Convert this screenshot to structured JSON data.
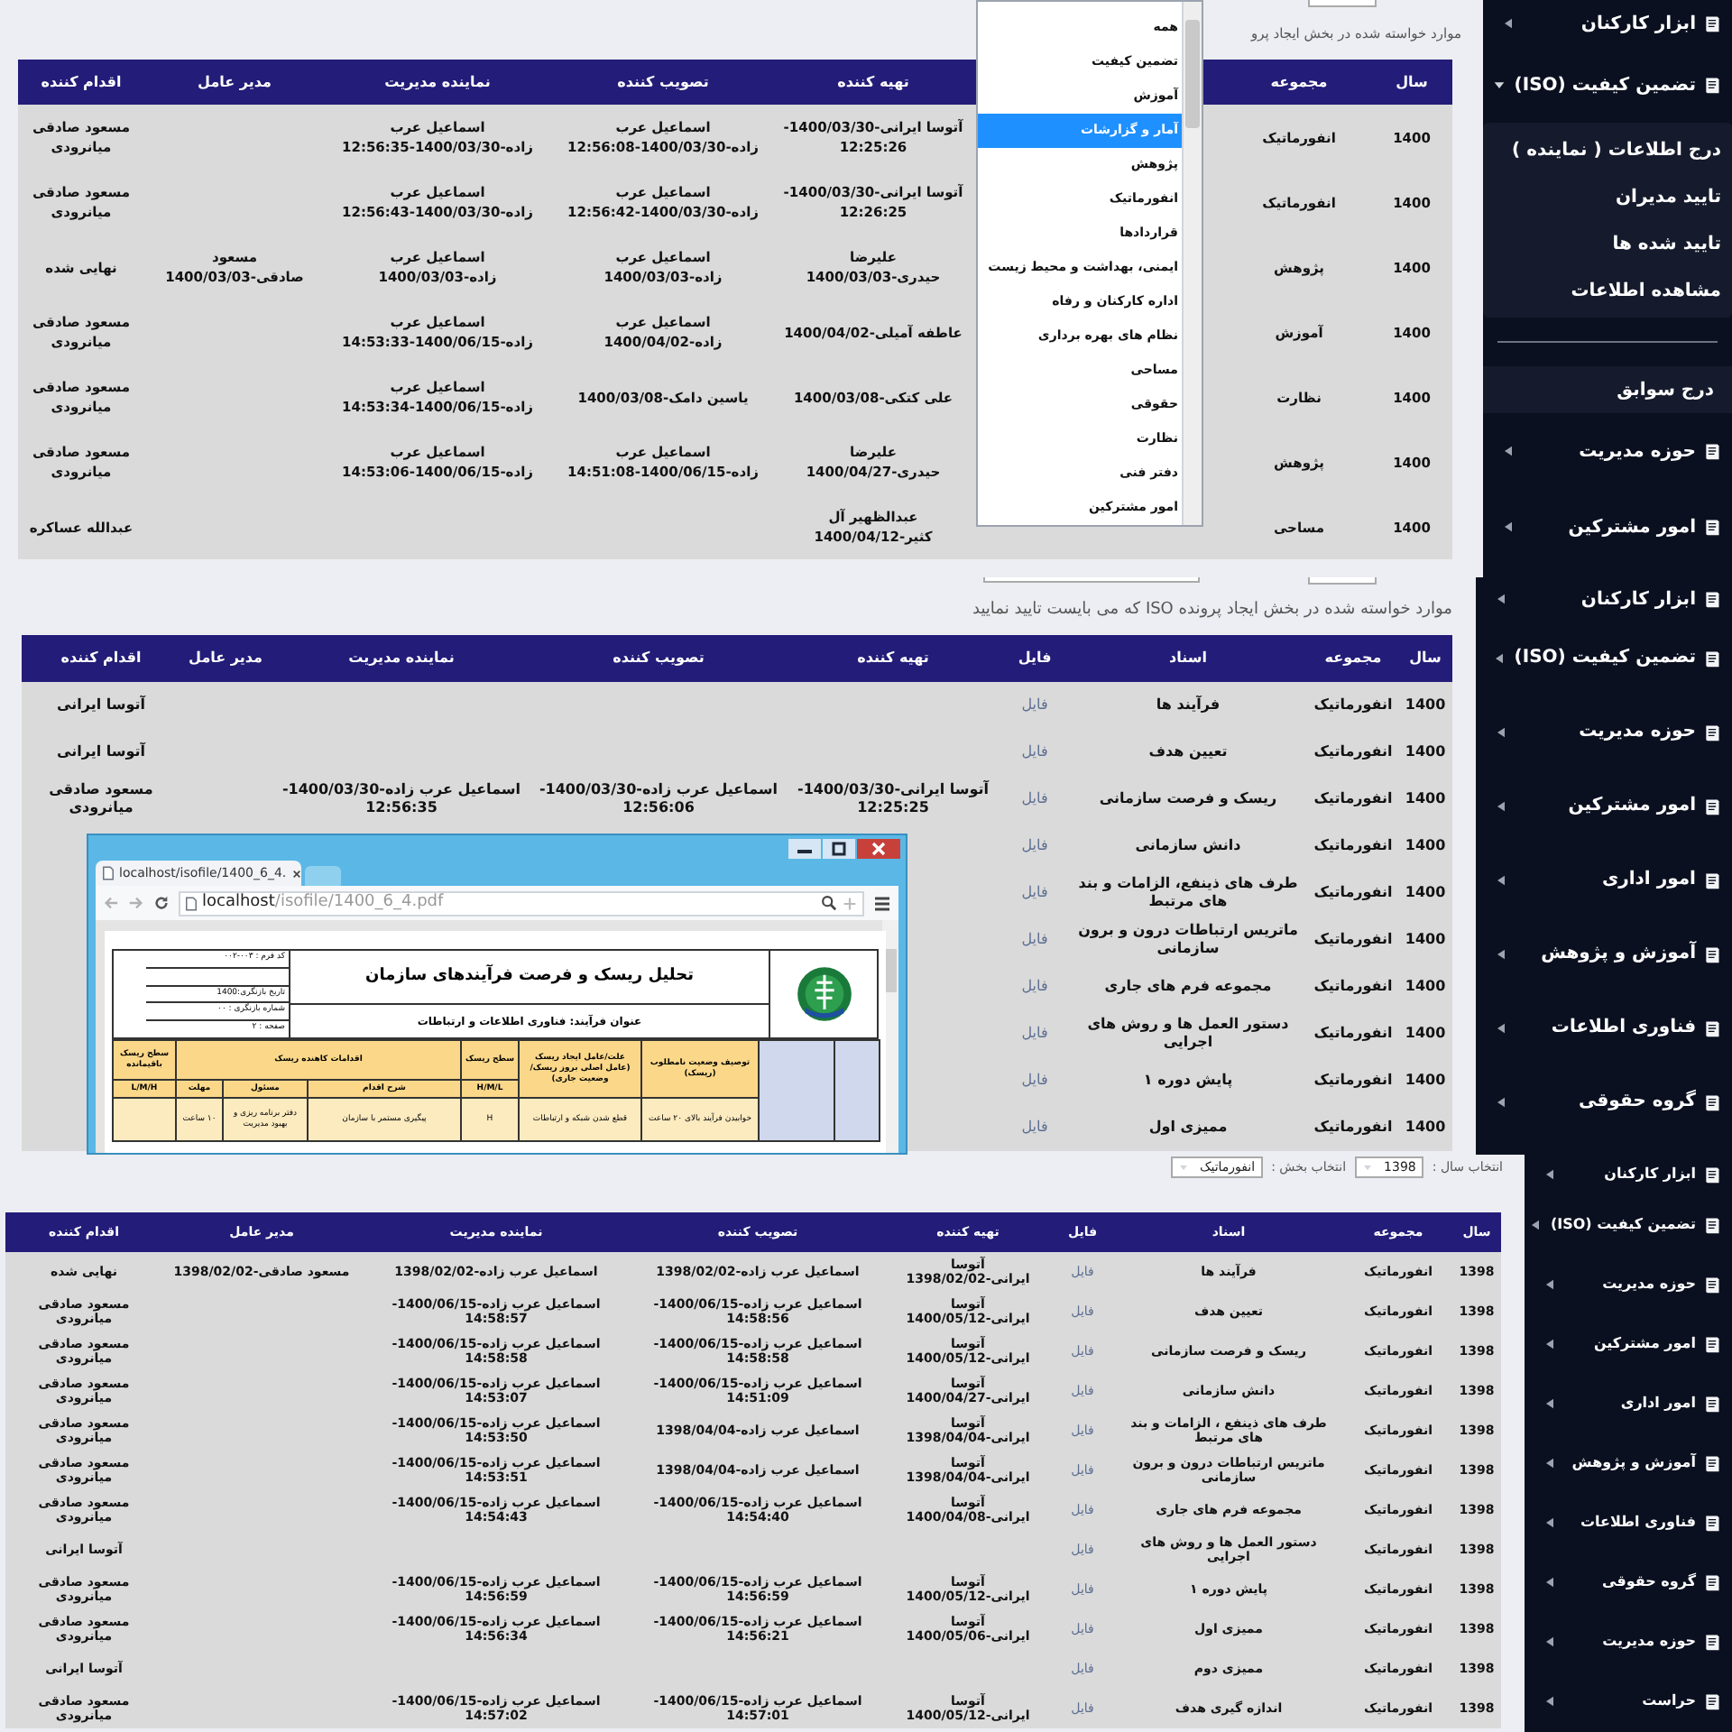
{
  "panels": [
    {
      "description": "موارد خواسته شده در بخش ایجاد پرو",
      "columns": [
        {
          "label": "سال",
          "kind": "text"
        },
        {
          "label": "مجموعه",
          "kind": "text"
        },
        {
          "label": "تهیه کننده",
          "kind": "text"
        },
        {
          "label": "تصویب کننده",
          "kind": "text"
        },
        {
          "label": "نماینده مدیریت",
          "kind": "text"
        },
        {
          "label": "مدیر عامل",
          "kind": "text"
        },
        {
          "label": "اقدام کننده",
          "kind": "text"
        }
      ],
      "rows": [
        [
          "1400",
          "انفورماتیک",
          "آتوسا ایرانی-1400/03/30-12:25:26",
          "اسماعیل عرب زاده-1400/03/30-12:56:08",
          "اسماعیل عرب زاده-1400/03/30-12:56:35",
          null,
          "مسعود صادقی میانرودی"
        ],
        [
          "1400",
          "انفورماتیک",
          "آتوسا ایرانی-1400/03/30-12:26:25",
          "اسماعیل عرب زاده-1400/03/30-12:56:42",
          "اسماعیل عرب زاده-1400/03/30-12:56:43",
          null,
          "مسعود صادقی میانرودی"
        ],
        [
          "1400",
          "پژوهش",
          "علیرضا حیدری-1400/03/03",
          "اسماعیل عرب زاده-1400/03/03",
          "اسماعیل عرب زاده-1400/03/03",
          "مسعود صادقی-1400/03/03",
          "نهایی شده"
        ],
        [
          "1400",
          "آموزش",
          "عاطفه آمیلی-1400/04/02",
          "اسماعیل عرب زاده-1400/04/02",
          "اسماعیل عرب زاده-1400/06/15-14:53:33",
          null,
          "مسعود صادقی میانرودی"
        ],
        [
          "1400",
          "نظارت",
          "علی کتکی-1400/03/08",
          "یاسین دامک-1400/03/08",
          "اسماعیل عرب زاده-1400/06/15-14:53:34",
          null,
          "مسعود صادقی میانرودی"
        ],
        [
          "1400",
          "پژوهش",
          "علیرضا حیدری-1400/04/27",
          "اسماعیل عرب زاده-1400/06/15-14:51:08",
          "اسماعیل عرب زاده-1400/06/15-14:53:06",
          null,
          "مسعود صادقی میانرودی"
        ],
        [
          "1400",
          "مساحی",
          "عبدالظهیر آل کثیر-1400/04/12",
          null,
          null,
          null,
          "عبدالله عساکره"
        ]
      ],
      "dropdown": {
        "options": [
          {
            "label": "همه",
            "selected": false
          },
          {
            "label": "تضمین کیفیت",
            "selected": false
          },
          {
            "label": "آموزش",
            "selected": false
          },
          {
            "label": "آمار و گزارشات",
            "selected": true
          },
          {
            "label": "پژوهش",
            "selected": false
          },
          {
            "label": "انفورماتیک",
            "selected": false
          },
          {
            "label": "قراردادها",
            "selected": false
          },
          {
            "label": "ایمنی، بهداشت و محیط زیست",
            "selected": false
          },
          {
            "label": "اداره کارکنان و رفاه",
            "selected": false
          },
          {
            "label": "نظام های بهره برداری",
            "selected": false
          },
          {
            "label": "مساحی",
            "selected": false
          },
          {
            "label": "حقوقی",
            "selected": false
          },
          {
            "label": "نظارت",
            "selected": false
          },
          {
            "label": "دفتر فنی",
            "selected": false
          },
          {
            "label": "امور مشترکین",
            "selected": false
          }
        ]
      },
      "sidebar": [
        {
          "kind": "menu",
          "label": "ابزار کارکنان",
          "expanded": false
        },
        {
          "kind": "menu",
          "label": "تضمین کیفیت (ISO)",
          "expanded": true,
          "children": [
            {
              "label": "درج اطلاعات ( نماینده )"
            },
            {
              "label": "تایید مدیران"
            },
            {
              "label": "تایید شده ها"
            },
            {
              "label": "مشاهده اطلاعات"
            }
          ]
        },
        {
          "kind": "divider"
        },
        {
          "kind": "link",
          "label": "درج سوابق"
        },
        {
          "kind": "menu",
          "label": "حوزه مدیریت",
          "expanded": false
        },
        {
          "kind": "menu",
          "label": "امور مشترکین",
          "expanded": false
        }
      ]
    },
    {
      "description": "موارد خواسته شده در بخش ایجاد پرونده ISO که می بایست تایید نمایید",
      "columns": [
        {
          "label": "سال",
          "kind": "text"
        },
        {
          "label": "مجموعه",
          "kind": "text"
        },
        {
          "label": "اسناد",
          "kind": "text"
        },
        {
          "label": "فایل",
          "kind": "link"
        },
        {
          "label": "تهیه کننده",
          "kind": "text"
        },
        {
          "label": "تصویب کننده",
          "kind": "text"
        },
        {
          "label": "نماینده مدیریت",
          "kind": "text"
        },
        {
          "label": "مدیر عامل",
          "kind": "text"
        },
        {
          "label": "اقدام کننده",
          "kind": "text"
        }
      ],
      "rows": [
        [
          "1400",
          "انفورماتیک",
          "فرآیند ها",
          "فایل",
          null,
          null,
          null,
          null,
          "آتوسا ایرانی"
        ],
        [
          "1400",
          "انفورماتیک",
          "تعیین هدف",
          "فایل",
          null,
          null,
          null,
          null,
          "آتوسا ایرانی"
        ],
        [
          "1400",
          "انفورماتیک",
          "ریسک و فرصت سازمانی",
          "فایل",
          "آتوسا ایرانی-1400/03/30-12:25:25",
          "اسماعیل عرب زاده-1400/03/30-12:56:06",
          "اسماعیل عرب زاده-1400/03/30-12:56:35",
          null,
          "مسعود صادقی میانرودی"
        ],
        [
          "1400",
          "انفورماتیک",
          "دانش سازمانی",
          "فایل",
          null,
          null,
          null,
          null,
          null
        ],
        [
          "1400",
          "انفورماتیک",
          "طرف های ذینفع، الزامات و بند های مرتبط",
          "فایل",
          null,
          null,
          null,
          null,
          null
        ],
        [
          "1400",
          "انفورماتیک",
          "ماتریس ارتباطات درون و برون سازمانی",
          "فایل",
          null,
          null,
          null,
          null,
          null
        ],
        [
          "1400",
          "انفورماتیک",
          "مجموعه فرم های جاری",
          "فایل",
          null,
          null,
          null,
          null,
          null
        ],
        [
          "1400",
          "انفورماتیک",
          "دستور العمل ها و روش های اجرایی",
          "فایل",
          null,
          null,
          null,
          null,
          null
        ],
        [
          "1400",
          "انفورماتیک",
          "پایش دوره ۱",
          "فایل",
          null,
          null,
          null,
          null,
          null
        ],
        [
          "1400",
          "انفورماتیک",
          "ممیزی اول",
          "فایل",
          null,
          null,
          null,
          null,
          null
        ]
      ],
      "browser_window": {
        "tab_title": "localhost/isofile/1400_6_4.",
        "url_host": "localhost",
        "url_path": "/isofile/1400_6_4.pdf",
        "document": {
          "info": [
            "کد فرم : ۰۰۳-۰۰۲",
            "تاریخ بازنگری:1400",
            "شماره بازنگری : ۰۰",
            "صفحه : ۲"
          ],
          "title": "تحلیل ریسک و فرصت فرآیندهای سازمان",
          "subtitle": "عنوان فرآیند: فناوری اطلاعات و ارتباطات",
          "headers": [
            "توصیف وضعیت نامطلوب (ریسک)",
            "علت/عامل ایجاد ریسک (عامل اصلی بروز ریسک/ وضعیت جاری)",
            "سطح ریسک",
            "اقدامات کاهنده ریسک",
            "سطح ریسک باقیمانده"
          ],
          "subheaders": [
            "H/M/L",
            "شرح اقدام",
            "مسئول",
            "مهلت",
            "L/M/H"
          ],
          "row": [
            "خوابیدن فرآیند بالای ۲۰ ساعت",
            "قطع شدن شبکه و ارتباطات",
            "H",
            "پیگیری مستمر با سازمان",
            "دفتر برنامه ریزی و بهبود مدیریت",
            "۱۰ ساعت"
          ]
        }
      },
      "sidebar": [
        {
          "kind": "menu",
          "label": "ابزار کارکنان",
          "expanded": false
        },
        {
          "kind": "menu",
          "label": "تضمین کیفیت (ISO)",
          "expanded": false
        },
        {
          "kind": "menu",
          "label": "حوزه مدیریت",
          "expanded": false
        },
        {
          "kind": "menu",
          "label": "امور مشترکین",
          "expanded": false
        },
        {
          "kind": "menu",
          "label": "امور اداری",
          "expanded": false
        },
        {
          "kind": "menu",
          "label": "آموزش و پژوهش",
          "expanded": false
        },
        {
          "kind": "menu",
          "label": "فناوری اطلاعات",
          "expanded": false
        },
        {
          "kind": "menu",
          "label": "گروه حقوقی",
          "expanded": false
        }
      ]
    },
    {
      "filters": [
        {
          "label": "انتخاب سال :",
          "value": "1398"
        },
        {
          "label": "انتخاب بخش :",
          "value": "انفورماتیک"
        }
      ],
      "columns": [
        {
          "label": "سال",
          "kind": "text"
        },
        {
          "label": "مجموعه",
          "kind": "text"
        },
        {
          "label": "اسناد",
          "kind": "text"
        },
        {
          "label": "فایل",
          "kind": "link"
        },
        {
          "label": "تهیه کننده",
          "kind": "text"
        },
        {
          "label": "تصویب کننده",
          "kind": "text"
        },
        {
          "label": "نماینده مدیریت",
          "kind": "text"
        },
        {
          "label": "مدیر عامل",
          "kind": "text"
        },
        {
          "label": "اقدام کننده",
          "kind": "text"
        }
      ],
      "rows": [
        [
          "1398",
          "انفورماتیک",
          "فرآیند ها",
          "فایل",
          "آتوسا ایرانی-1398/02/02",
          "اسماعیل عرب زاده-1398/02/02",
          "اسماعیل عرب زاده-1398/02/02",
          "مسعود صادقی-1398/02/02",
          "نهایی شده"
        ],
        [
          "1398",
          "انفورماتیک",
          "تعیین هدف",
          "فایل",
          "آتوسا ایرانی-1400/05/12",
          "اسماعیل عرب زاده-1400/06/15-14:58:56",
          "اسماعیل عرب زاده-1400/06/15-14:58:57",
          null,
          "مسعود صادقی میانرودی"
        ],
        [
          "1398",
          "انفورماتیک",
          "ریسک و فرصت سازمانی",
          "فایل",
          "آتوسا ایرانی-1400/05/12",
          "اسماعیل عرب زاده-1400/06/15-14:58:58",
          "اسماعیل عرب زاده-1400/06/15-14:58:58",
          null,
          "مسعود صادقی میانرودی"
        ],
        [
          "1398",
          "انفورماتیک",
          "دانش سازمانی",
          "فایل",
          "آتوسا ایرانی-1400/04/27",
          "اسماعیل عرب زاده-1400/06/15-14:51:09",
          "اسماعیل عرب زاده-1400/06/15-14:53:07",
          null,
          "مسعود صادقی میانرودی"
        ],
        [
          "1398",
          "انفورماتیک",
          "طرف های ذینفع ، الزامات و بند های مرتبط",
          "فایل",
          "آتوسا ایرانی-1398/04/04",
          "اسماعیل عرب زاده-1398/04/04",
          "اسماعیل عرب زاده-1400/06/15-14:53:50",
          null,
          "مسعود صادقی میانرودی"
        ],
        [
          "1398",
          "انفورماتیک",
          "ماتریس ارتباطات درون و برون سازمانی",
          "فایل",
          "آتوسا ایرانی-1398/04/04",
          "اسماعیل عرب زاده-1398/04/04",
          "اسماعیل عرب زاده-1400/06/15-14:53:51",
          null,
          "مسعود صادقی میانرودی"
        ],
        [
          "1398",
          "انفورماتیک",
          "مجموعه فرم های جاری",
          "فایل",
          "آتوسا ایرانی-1400/04/08",
          "اسماعیل عرب زاده-1400/06/15-14:54:40",
          "اسماعیل عرب زاده-1400/06/15-14:54:43",
          null,
          "مسعود صادقی میانرودی"
        ],
        [
          "1398",
          "انفورماتیک",
          "دستور العمل ها و روش های اجرایی",
          "فایل",
          null,
          null,
          null,
          null,
          "آتوسا ایرانی"
        ],
        [
          "1398",
          "انفورماتیک",
          "پایش دوره ۱",
          "فایل",
          "آتوسا ایرانی-1400/05/12",
          "اسماعیل عرب زاده-1400/06/15-14:56:59",
          "اسماعیل عرب زاده-1400/06/15-14:56:59",
          null,
          "مسعود صادقی میانرودی"
        ],
        [
          "1398",
          "انفورماتیک",
          "ممیزی اول",
          "فایل",
          "آتوسا ایرانی-1400/05/06",
          "اسماعیل عرب زاده-1400/06/15-14:56:21",
          "اسماعیل عرب زاده-1400/06/15-14:56:34",
          null,
          "مسعود صادقی میانرودی"
        ],
        [
          "1398",
          "انفورماتیک",
          "ممیزی دوم",
          "فایل",
          null,
          null,
          null,
          null,
          "آتوسا ایرانی"
        ],
        [
          "1398",
          "انفورماتیک",
          "اندازه گیری هدف",
          "فایل",
          "آتوسا ایرانی-1400/05/12",
          "اسماعیل عرب زاده-1400/06/15-14:57:01",
          "اسماعیل عرب زاده-1400/06/15-14:57:02",
          null,
          "مسعود صادقی میانرودی"
        ]
      ],
      "sidebar": [
        {
          "kind": "menu",
          "label": "ابزار کارکنان",
          "expanded": false
        },
        {
          "kind": "menu",
          "label": "تضمین کیفیت (ISO)",
          "expanded": false
        },
        {
          "kind": "menu",
          "label": "حوزه مدیریت",
          "expanded": false
        },
        {
          "kind": "menu",
          "label": "امور مشترکین",
          "expanded": false
        },
        {
          "kind": "menu",
          "label": "امور اداری",
          "expanded": false
        },
        {
          "kind": "menu",
          "label": "آموزش و پژوهش",
          "expanded": false
        },
        {
          "kind": "menu",
          "label": "فناوری اطلاعات",
          "expanded": false
        },
        {
          "kind": "menu",
          "label": "گروه حقوقی",
          "expanded": false
        },
        {
          "kind": "menu",
          "label": "حوزه مدیریت",
          "expanded": false
        },
        {
          "kind": "menu",
          "label": "حراست",
          "expanded": false
        }
      ]
    }
  ]
}
